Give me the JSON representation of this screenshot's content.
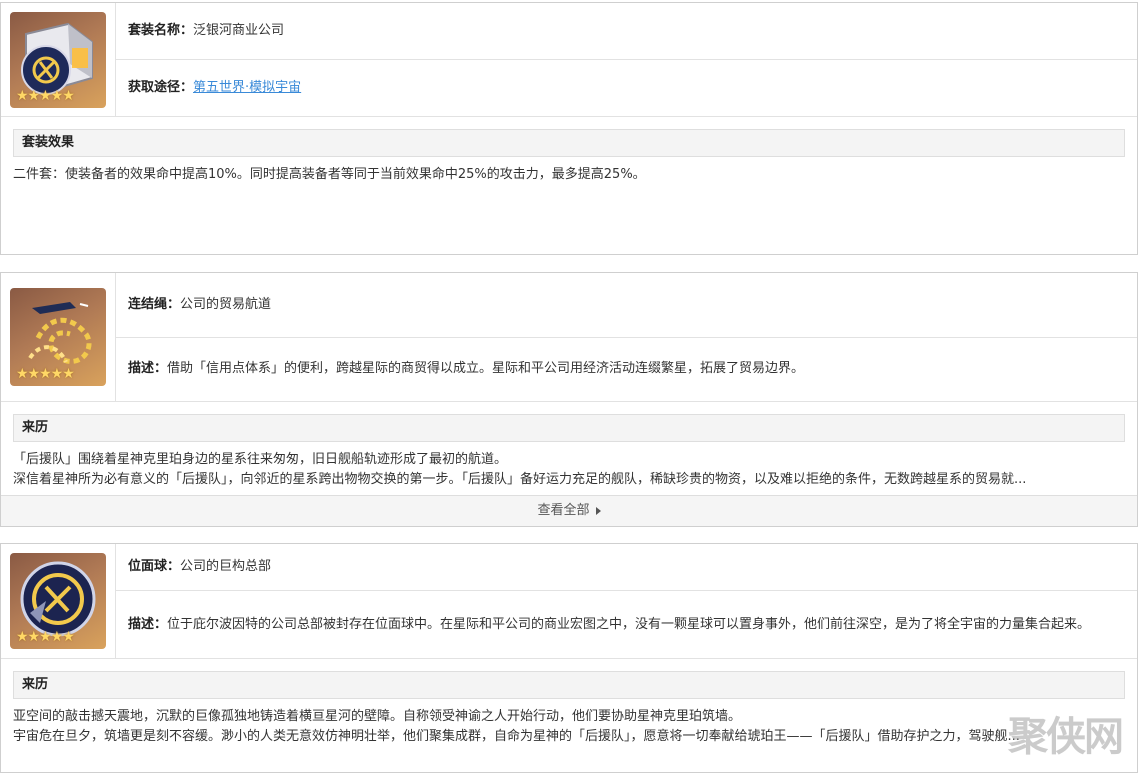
{
  "card1": {
    "set_name_label": "套装名称：",
    "set_name": "泛银河商业公司",
    "source_label": "获取途径：",
    "source_link": "第五世界·模拟宇宙",
    "effect_title": "套装效果",
    "effect_text": "二件套：使装备者的效果命中提高10%。同时提高装备者等同于当前效果命中25%的攻击力，最多提高25%。",
    "icon": "relic-box-icon"
  },
  "card2": {
    "name_label": "连结绳：",
    "name": "公司的贸易航道",
    "desc_label": "描述：",
    "desc": "借助「信用点体系」的便利，跨越星际的商贸得以成立。星际和平公司用经济活动连缀繁星，拓展了贸易边界。",
    "lore_title": "来历",
    "lore_lines": [
      "「后援队」围绕着星神克里珀身边的星系往来匆匆，旧日舰船轨迹形成了最初的航道。",
      "深信着星神所为必有意义的「后援队」，向邻近的星系跨出物物交换的第一步。「后援队」备好运力充足的舰队，稀缺珍贵的物资，以及难以拒绝的条件，无数跨越星系的贸易就..."
    ],
    "view_all": "查看全部",
    "icon": "link-rope-icon"
  },
  "card3": {
    "name_label": "位面球：",
    "name": "公司的巨构总部",
    "desc_label": "描述：",
    "desc": "位于庇尔波因特的公司总部被封存在位面球中。在星际和平公司的商业宏图之中，没有一颗星球可以置身事外，他们前往深空，是为了将全宇宙的力量集合起来。",
    "lore_title": "来历",
    "lore_lines": [
      "亚空间的敲击撼天震地，沉默的巨像孤独地铸造着横亘星河的壁障。自称领受神谕之人开始行动，他们要协助星神克里珀筑墙。",
      "宇宙危在旦夕，筑墙更是刻不容缓。渺小的人类无意效仿神明壮举，他们聚集成群，自命为星神的「后援队」，愿意将一切奉献给琥珀王——「后援队」借助存护之力，驾驶舰..."
    ],
    "icon": "planar-sphere-icon"
  },
  "stars": "★★★★★",
  "watermark": "聚侠网",
  "colors": {
    "link": "#3a8ad8",
    "star": "#ffd866",
    "icon_bg": "#b07a55"
  }
}
